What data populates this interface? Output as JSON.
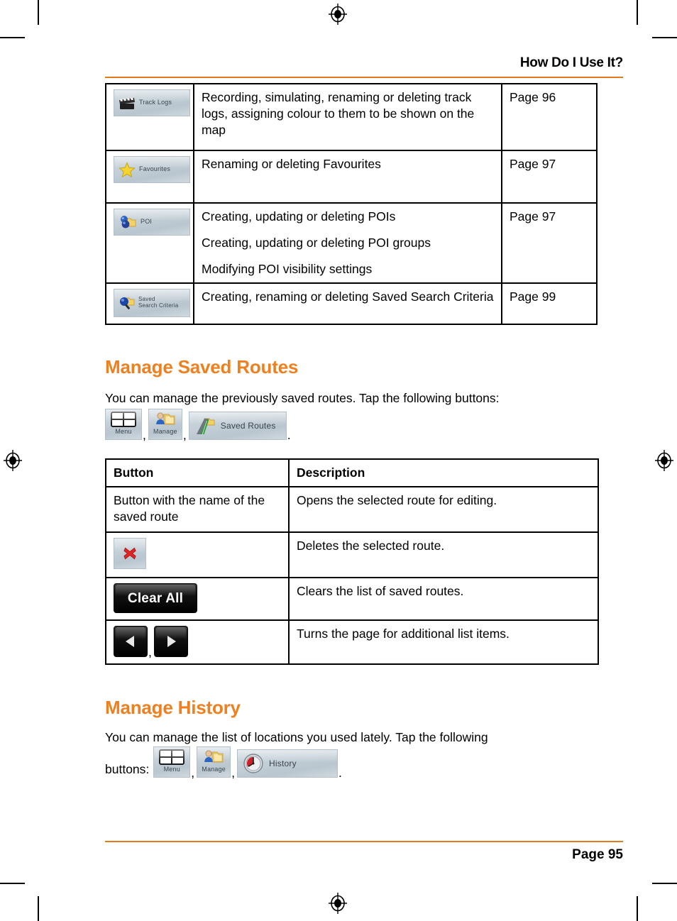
{
  "header": {
    "title": "How Do I Use It?",
    "rule_color": "#e07b1e"
  },
  "footer": {
    "page_label": "Page 95"
  },
  "feature_table": {
    "rows": [
      {
        "icon_label": "Track Logs",
        "icon_name": "track-logs-icon",
        "description": "Recording, simulating, renaming or deleting track logs, assigning colour to them to be shown on the map",
        "page": "Page 96"
      },
      {
        "icon_label": "Favourites",
        "icon_name": "favourites-icon",
        "description": "Renaming or deleting Favourites",
        "page": "Page 97"
      },
      {
        "icon_label": "POI",
        "icon_name": "poi-icon",
        "description_lines": [
          "Creating, updating or deleting POIs",
          "Creating, updating or deleting POI groups",
          "Modifying POI visibility settings"
        ],
        "page": "Page 97"
      },
      {
        "icon_label_line1": "Saved",
        "icon_label_line2": "Search Criteria",
        "icon_name": "saved-search-criteria-icon",
        "description": "Creating, renaming or deleting Saved Search Criteria",
        "page": "Page 99"
      }
    ]
  },
  "manage_saved_routes": {
    "heading": "Manage Saved Routes",
    "heading_color": "#ee8020",
    "intro": "You can manage the previously saved routes. Tap the following buttons:",
    "buttons": [
      {
        "label": "Menu",
        "icon": "menu-grid-icon"
      },
      {
        "label": "Manage",
        "icon": "manage-folder-person-icon"
      },
      {
        "label": "Saved Routes",
        "icon": "saved-routes-road-icon"
      }
    ],
    "separator": ",",
    "terminator": ".",
    "table": {
      "columns": [
        "Button",
        "Description"
      ],
      "rows": [
        {
          "button_text": "Button with the name of the saved route",
          "button_kind": "text",
          "description": "Opens the selected route for editing."
        },
        {
          "button_text": "",
          "button_kind": "delete-icon",
          "description": "Deletes the selected route."
        },
        {
          "button_text": "Clear All",
          "button_kind": "clear-all-button",
          "description": "Clears the list of saved routes."
        },
        {
          "button_text": "",
          "button_kind": "page-arrows",
          "description": "Turns the page for additional list items."
        }
      ]
    }
  },
  "manage_history": {
    "heading": "Manage History",
    "heading_color": "#ee8020",
    "intro": "You can manage the list of locations you used lately. Tap the following",
    "buttons_label": "buttons:",
    "buttons": [
      {
        "label": "Menu",
        "icon": "menu-grid-icon"
      },
      {
        "label": "Manage",
        "icon": "manage-folder-person-icon"
      },
      {
        "label": "History",
        "icon": "history-clock-icon"
      }
    ],
    "separator": ",",
    "terminator": "."
  }
}
